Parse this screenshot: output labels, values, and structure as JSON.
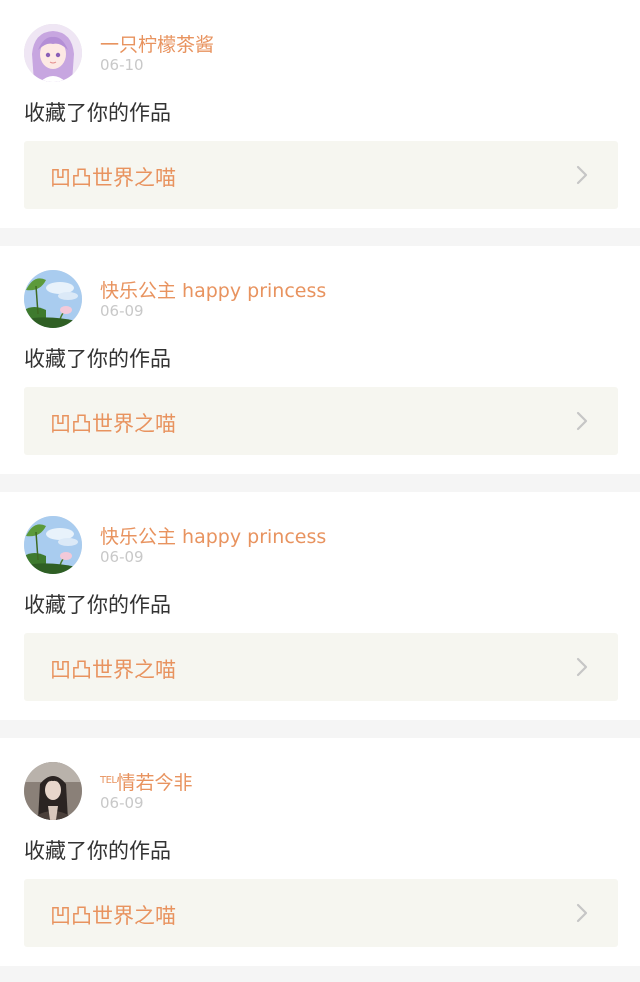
{
  "notifications": [
    {
      "avatar_icon": "anime-girl-avatar-icon",
      "username": "一只柠檬茶酱",
      "date": "06-10",
      "action": "收藏了你的作品",
      "work_title": "凹凸世界之喵"
    },
    {
      "avatar_icon": "lotus-sky-avatar-icon",
      "username": "快乐公主 happy princess",
      "date": "06-09",
      "action": "收藏了你的作品",
      "work_title": "凹凸世界之喵"
    },
    {
      "avatar_icon": "lotus-sky-avatar-icon",
      "username": "快乐公主 happy princess",
      "date": "06-09",
      "action": "收藏了你的作品",
      "work_title": "凹凸世界之喵"
    },
    {
      "avatar_icon": "dark-portrait-avatar-icon",
      "username_tag": "TEL",
      "username": "情若今非",
      "date": "06-09",
      "action": "收藏了你的作品",
      "work_title": "凹凸世界之喵"
    }
  ],
  "colors": {
    "accent": "#e8935f",
    "date": "#c8c8c8",
    "text": "#333333",
    "link_bg": "#f6f6f0",
    "page_bg": "#f5f5f5"
  }
}
